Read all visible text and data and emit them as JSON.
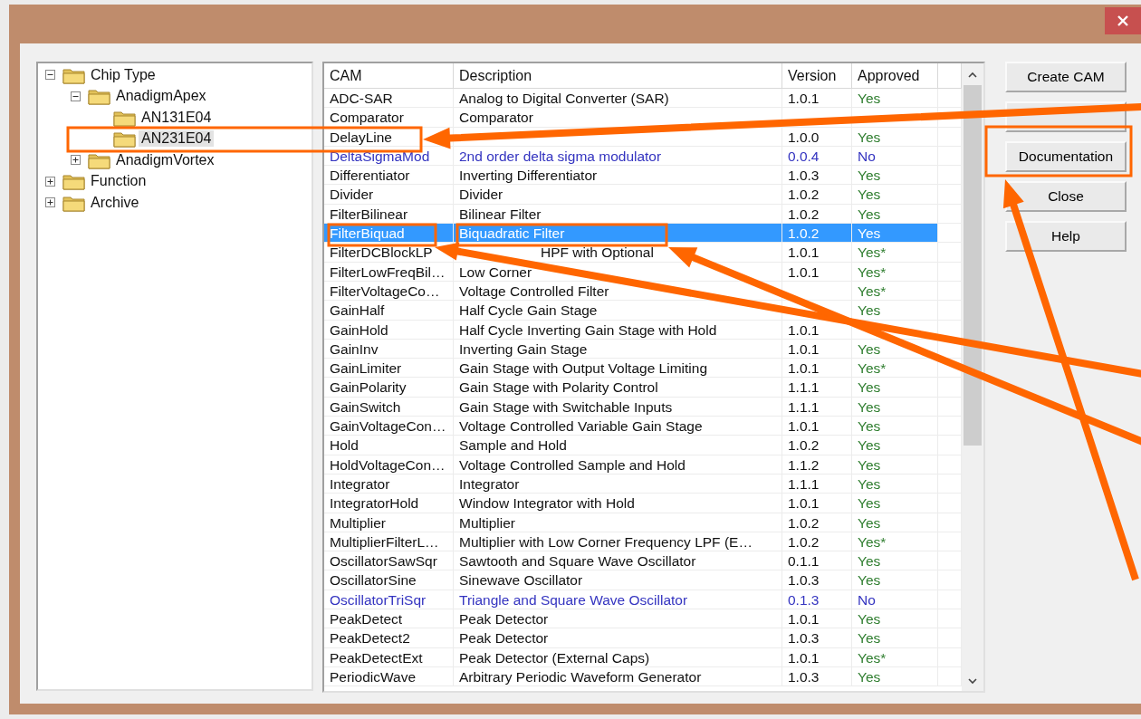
{
  "tree": [
    {
      "label": "Chip Type",
      "expanded": true,
      "selected": false,
      "children": [
        {
          "label": "AnadigmApex",
          "expanded": true,
          "selected": false,
          "children": [
            {
              "label": "AN131E04",
              "selected": false
            },
            {
              "label": "AN231E04",
              "selected": true
            }
          ]
        },
        {
          "label": "AnadigmVortex",
          "expanded": false,
          "selected": false
        }
      ]
    },
    {
      "label": "Function",
      "expanded": false,
      "selected": false
    },
    {
      "label": "Archive",
      "expanded": false,
      "selected": false
    }
  ],
  "table": {
    "columns": [
      "CAM",
      "Description",
      "Version",
      "Approved"
    ],
    "rows": [
      {
        "cam": "ADC-SAR",
        "description": "Analog to Digital Converter (SAR)",
        "version": "1.0.1",
        "approved": "Yes",
        "kind": "approved",
        "selected": false
      },
      {
        "cam": "Comparator",
        "description": "Comparator",
        "kind": "approved",
        "selected": false
      },
      {
        "cam": "DelayLine",
        "version": "1.0.0",
        "approved": "Yes",
        "kind": "approved",
        "selected": false
      },
      {
        "cam": "DeltaSigmaMod",
        "description": "2nd order delta sigma modulator",
        "version": "0.0.4",
        "approved": "No",
        "kind": "unapproved",
        "selected": false
      },
      {
        "cam": "Differentiator",
        "description": "Inverting Differentiator",
        "version": "1.0.3",
        "approved": "Yes",
        "kind": "approved",
        "selected": false
      },
      {
        "cam": "Divider",
        "description": "Divider",
        "version": "1.0.2",
        "approved": "Yes",
        "kind": "approved",
        "selected": false
      },
      {
        "cam": "FilterBilinear",
        "description": "Bilinear Filter",
        "version": "1.0.2",
        "approved": "Yes",
        "kind": "approved",
        "selected": false
      },
      {
        "cam": "FilterBiquad",
        "description": "Biquadratic Filter",
        "version": "1.0.2",
        "approved": "Yes",
        "kind": "approved",
        "selected": true
      },
      {
        "cam": "FilterDCBlockLP",
        "description": "HPF with Optional",
        "description_start_hidden": true,
        "version": "1.0.1",
        "approved": "Yes*",
        "kind": "approved",
        "selected": false
      },
      {
        "cam": "FilterLowFreqBil…",
        "description": "Low Corner",
        "version": "1.0.1",
        "approved": "Yes*",
        "kind": "approved",
        "selected": false
      },
      {
        "cam": "FilterVoltageCo…",
        "description": "Voltage Controlled Filter",
        "approved": "Yes*",
        "kind": "approved",
        "selected": false
      },
      {
        "cam": "GainHalf",
        "description": "Half Cycle Gain Stage",
        "approved": "Yes",
        "kind": "approved",
        "selected": false
      },
      {
        "cam": "GainHold",
        "description": "Half Cycle Inverting Gain Stage with Hold",
        "version": "1.0.1",
        "kind": "approved",
        "selected": false
      },
      {
        "cam": "GainInv",
        "description": "Inverting Gain Stage",
        "version": "1.0.1",
        "approved": "Yes",
        "kind": "approved",
        "selected": false
      },
      {
        "cam": "GainLimiter",
        "description": "Gain Stage with Output Voltage Limiting",
        "version": "1.0.1",
        "approved": "Yes*",
        "kind": "approved",
        "selected": false
      },
      {
        "cam": "GainPolarity",
        "description": "Gain Stage with Polarity Control",
        "version": "1.1.1",
        "approved": "Yes",
        "kind": "approved",
        "selected": false
      },
      {
        "cam": "GainSwitch",
        "description": "Gain Stage with Switchable Inputs",
        "version": "1.1.1",
        "approved": "Yes",
        "kind": "approved",
        "selected": false
      },
      {
        "cam": "GainVoltageCon…",
        "description": "Voltage Controlled Variable Gain Stage",
        "version": "1.0.1",
        "approved": "Yes",
        "kind": "approved",
        "selected": false
      },
      {
        "cam": "Hold",
        "description": "Sample and Hold",
        "version": "1.0.2",
        "approved": "Yes",
        "kind": "approved",
        "selected": false
      },
      {
        "cam": "HoldVoltageCon…",
        "description": "Voltage Controlled Sample and Hold",
        "version": "1.1.2",
        "approved": "Yes",
        "kind": "approved",
        "selected": false
      },
      {
        "cam": "Integrator",
        "description": "Integrator",
        "version": "1.1.1",
        "approved": "Yes",
        "kind": "approved",
        "selected": false
      },
      {
        "cam": "IntegratorHold",
        "description": "Window Integrator with Hold",
        "version": "1.0.1",
        "approved": "Yes",
        "kind": "approved",
        "selected": false
      },
      {
        "cam": "Multiplier",
        "description": "Multiplier",
        "version": "1.0.2",
        "approved": "Yes",
        "kind": "approved",
        "selected": false
      },
      {
        "cam": "MultiplierFilterL…",
        "description": "Multiplier with Low Corner Frequency LPF (E…",
        "version": "1.0.2",
        "approved": "Yes*",
        "kind": "approved",
        "selected": false
      },
      {
        "cam": "OscillatorSawSqr",
        "description": "Sawtooth and Square Wave Oscillator",
        "version": "0.1.1",
        "approved": "Yes",
        "kind": "approved",
        "selected": false
      },
      {
        "cam": "OscillatorSine",
        "description": "Sinewave Oscillator",
        "version": "1.0.3",
        "approved": "Yes",
        "kind": "approved",
        "selected": false
      },
      {
        "cam": "OscillatorTriSqr",
        "description": "Triangle and Square Wave Oscillator",
        "version": "0.1.3",
        "approved": "No",
        "kind": "unapproved",
        "selected": false
      },
      {
        "cam": "PeakDetect",
        "description": "Peak Detector",
        "version": "1.0.1",
        "approved": "Yes",
        "kind": "approved",
        "selected": false
      },
      {
        "cam": "PeakDetect2",
        "description": "Peak Detector",
        "version": "1.0.3",
        "approved": "Yes",
        "kind": "approved",
        "selected": false
      },
      {
        "cam": "PeakDetectExt",
        "description": "Peak Detector (External Caps)",
        "version": "1.0.1",
        "approved": "Yes*",
        "kind": "approved",
        "selected": false
      },
      {
        "cam": "PeriodicWave",
        "description": "Arbitrary Periodic Waveform Generator",
        "version": "1.0.3",
        "approved": "Yes",
        "kind": "approved",
        "selected": false
      }
    ]
  },
  "buttons": [
    {
      "kind": "labeled",
      "label": "Create CAM"
    },
    {
      "kind": "blank"
    },
    {
      "kind": "labeled",
      "label": "Documentation"
    },
    {
      "kind": "labeled",
      "label": "Close"
    },
    {
      "kind": "labeled",
      "label": "Help"
    }
  ]
}
